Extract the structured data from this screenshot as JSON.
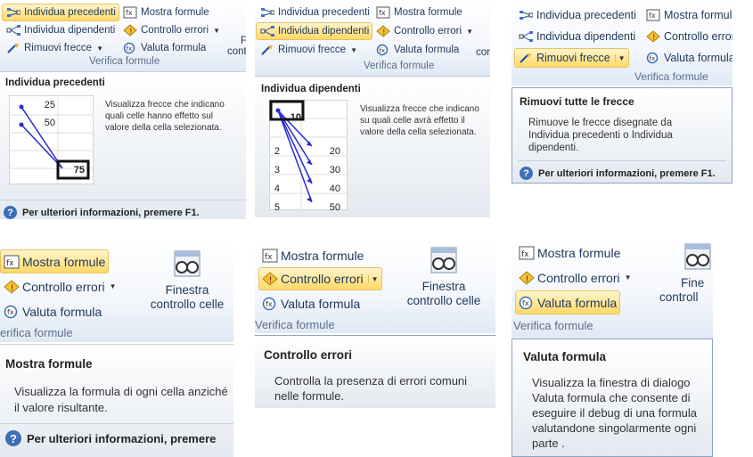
{
  "panel1": {
    "buttons": {
      "precedenti": "Individua precedenti",
      "dipendenti": "Individua dipendenti",
      "rimuovi": "Rimuovi frecce",
      "mostra": "Mostra formule",
      "controllo": "Controllo errori",
      "valuta": "Valuta formula"
    },
    "group": "Verifica formule",
    "cut_text_top": "F",
    "cut_text_bottom": "cont",
    "tip_title": "Individua precedenti",
    "tip_desc": "Visualizza frecce che indicano quali celle hanno effetto sul valore della cella selezionata.",
    "cells": [
      "25",
      "50",
      "75"
    ],
    "help": "Per ulteriori informazioni, premere F1."
  },
  "panel2": {
    "buttons": {
      "precedenti": "Individua precedenti",
      "dipendenti": "Individua dipendenti",
      "rimuovi": "Rimuovi frecce",
      "mostra": "Mostra formule",
      "controllo": "Controllo errori",
      "valuta": "Valuta formula"
    },
    "group": "Verifica formule",
    "cut_text": "cor",
    "tip_title": "Individua dipendenti",
    "tip_desc": "Visualizza frecce che indicano su quali celle avrà effetto il valore della cella selezionata.",
    "cells_top": "10",
    "rows": [
      {
        "a": "2",
        "b": "20"
      },
      {
        "a": "3",
        "b": "30"
      },
      {
        "a": "4",
        "b": "40"
      },
      {
        "a": "5",
        "b": "50"
      }
    ]
  },
  "panel3": {
    "buttons": {
      "precedenti": "Individua precedenti",
      "dipendenti": "Individua dipendenti",
      "rimuovi": "Rimuovi frecce",
      "mostra": "Mostra formule",
      "controllo": "Controllo errori",
      "valuta": "Valuta formula"
    },
    "group": "Verifica formule",
    "tip_title": "Rimuovi tutte le frecce",
    "tip_desc": "Rimuove le frecce disegnate da Individua precedenti o Individua dipendenti.",
    "help": "Per ulteriori informazioni, premere F1."
  },
  "panel4": {
    "buttons": {
      "mostra": "Mostra formule",
      "controllo": "Controllo errori",
      "valuta": "Valuta formula",
      "finestra_1": "Finestra",
      "finestra_2": "controllo celle"
    },
    "group": "erifica formule",
    "tip_title": "Mostra formule",
    "tip_desc": "Visualizza la formula di ogni cella anziché il valore risultante.",
    "help": "Per ulteriori informazioni, premere"
  },
  "panel5": {
    "buttons": {
      "mostra": "Mostra formule",
      "controllo": "Controllo errori",
      "valuta": "Valuta formula",
      "finestra_1": "Finestra",
      "finestra_2": "controllo celle"
    },
    "group": "Verifica formule",
    "tip_title": "Controllo errori",
    "tip_desc": "Controlla la presenza di errori comuni nelle formule."
  },
  "panel6": {
    "buttons": {
      "mostra": "Mostra formule",
      "controllo": "Controllo errori",
      "valuta": "Valuta formula",
      "finestra_1": "Fine",
      "finestra_2": "controll"
    },
    "group": "Verifica formule",
    "tip_title": "Valuta formula",
    "tip_desc": "Visualizza la finestra di dialogo Valuta formula che consente di eseguire il debug di una formula valutandone singolarmente ogni parte ."
  },
  "colors": {
    "selected": "#ffe69a",
    "ribbon_text": "#1e395b",
    "group_label": "#5d6f8a",
    "help_icon": "#3b6fb6",
    "arrow": "#2a2ad6"
  }
}
